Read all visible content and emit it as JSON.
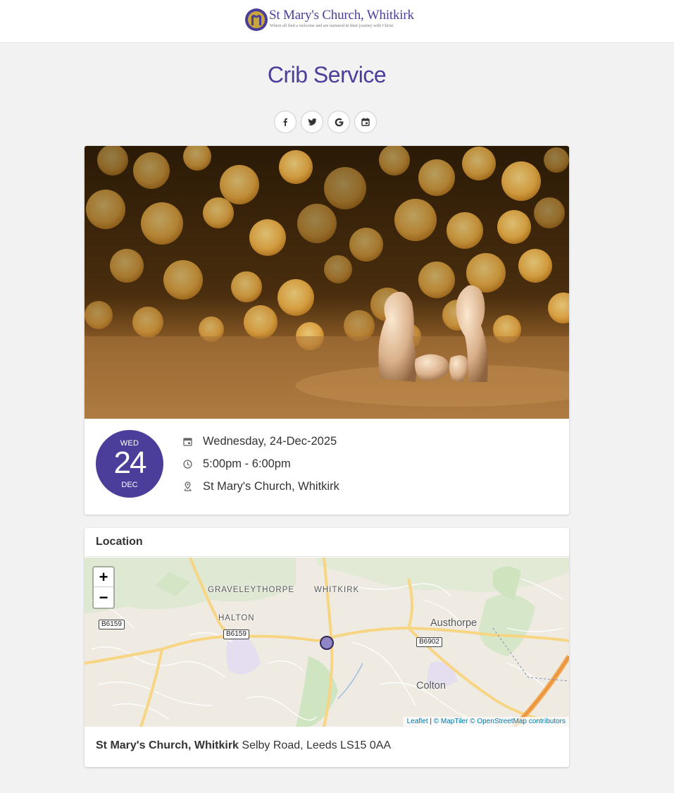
{
  "header": {
    "logo_name": "St Mary's Church, Whitkirk",
    "logo_tagline": "Where all find a welcome and are nurtured in their journey with Christ."
  },
  "event": {
    "title": "Crib Service",
    "share_buttons": [
      {
        "name": "facebook",
        "icon": "facebook-icon"
      },
      {
        "name": "twitter",
        "icon": "twitter-icon"
      },
      {
        "name": "google",
        "icon": "google-icon"
      },
      {
        "name": "calendar",
        "icon": "calendar-add-icon"
      }
    ],
    "date_badge": {
      "dow": "WED",
      "day": "24",
      "month": "DEC"
    },
    "date_text": "Wednesday, 24-Dec-2025",
    "time_text": "5:00pm - 6:00pm",
    "venue_text": "St Mary's Church, Whitkirk"
  },
  "location": {
    "heading": "Location",
    "map": {
      "zoom_in": "+",
      "zoom_out": "−",
      "labels": {
        "graveleythorpe": "GRAVELEYTHORPE",
        "whitkirk": "WHITKIRK",
        "halton": "HALTON",
        "austhorpe": "Austhorpe",
        "colton": "Colton"
      },
      "roads": {
        "b6159_a": "B6159",
        "b6159_b": "B6159",
        "b6902": "B6902"
      },
      "attribution": {
        "leaflet": "Leaflet",
        "sep": " | ",
        "maptiler": "© MapTiler",
        "osm": "© OpenStreetMap contributors"
      }
    },
    "address_name": "St Mary's Church, Whitkirk",
    "address_rest": "Selby Road, Leeds LS15 0AA"
  },
  "colors": {
    "brand": "#4b3e9b",
    "link": "#0078a8"
  }
}
